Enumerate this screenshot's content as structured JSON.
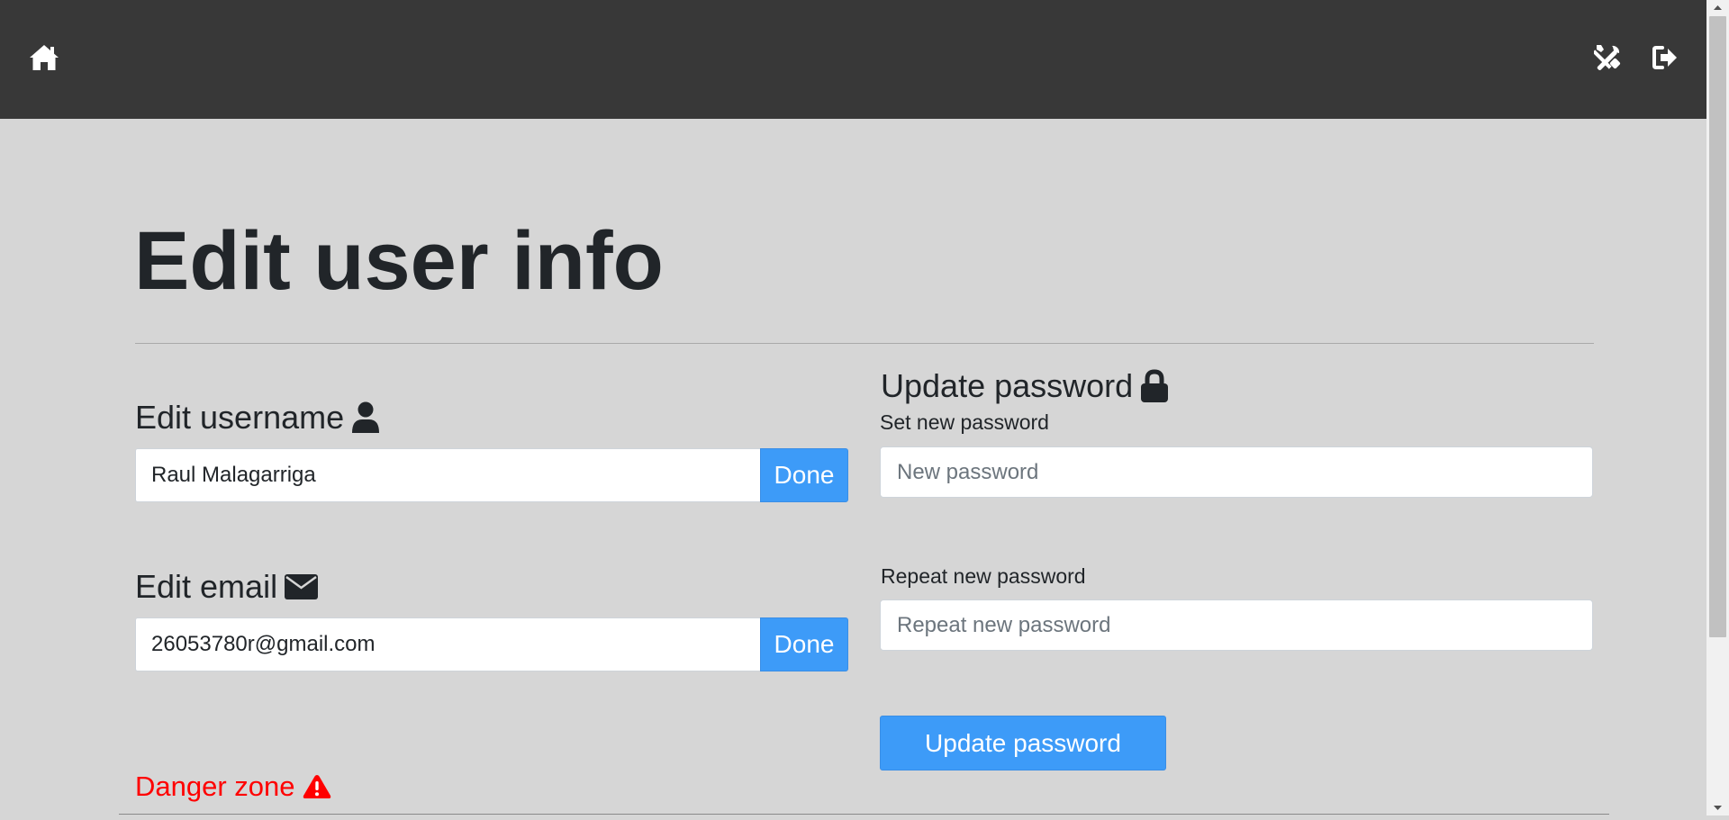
{
  "navbar": {
    "home_icon": "home-icon",
    "tools_icon": "tools-icon",
    "logout_icon": "logout-icon"
  },
  "page": {
    "title": "Edit user info"
  },
  "username_section": {
    "heading": "Edit username",
    "icon": "user-icon",
    "value": "Raul Malagarriga",
    "button_label": "Done"
  },
  "email_section": {
    "heading": "Edit email",
    "icon": "envelope-icon",
    "value": "26053780r@gmail.com",
    "button_label": "Done"
  },
  "password_section": {
    "heading": "Update password",
    "icon": "lock-icon",
    "new_label": "Set new password",
    "new_placeholder": "New password",
    "repeat_label": "Repeat new password",
    "repeat_placeholder": "Repeat new password",
    "button_label": "Update password"
  },
  "danger_section": {
    "heading": "Danger zone",
    "icon": "warning-icon"
  },
  "colors": {
    "navbar_bg": "#383838",
    "page_bg": "#d6d6d6",
    "accent": "#3d9bf8",
    "danger": "#ff0000"
  }
}
